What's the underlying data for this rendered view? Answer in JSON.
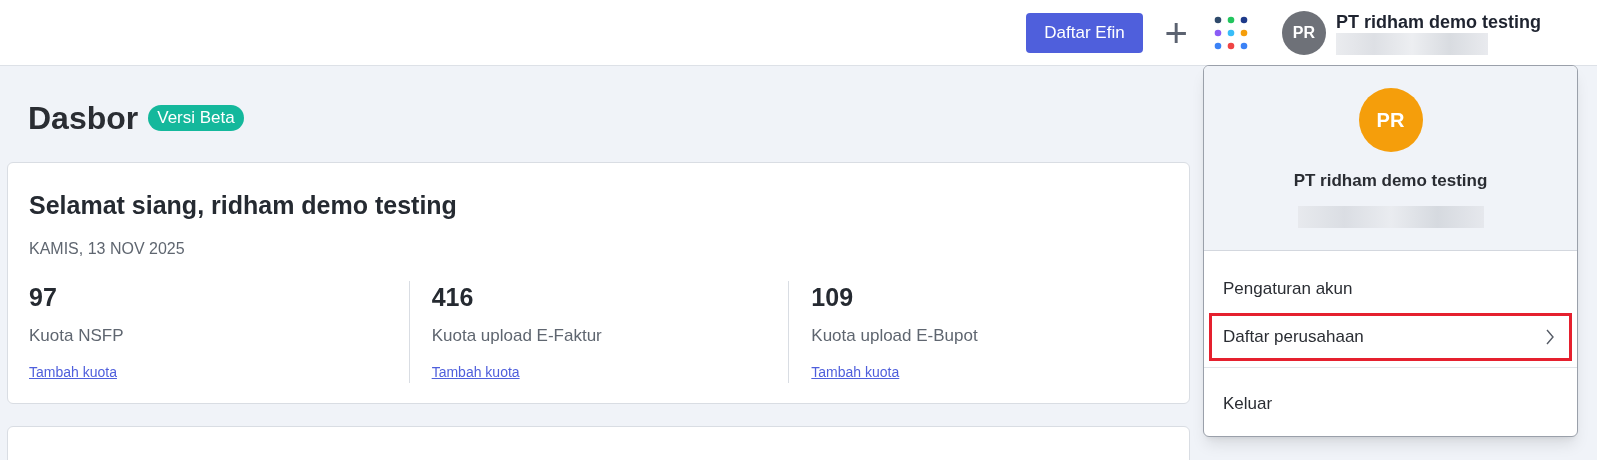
{
  "topbar": {
    "primary_button": "Daftar Efin",
    "plus_icon": "+",
    "account": {
      "initials": "PR",
      "name": "PT ridham demo testing"
    }
  },
  "page": {
    "title": "Dasbor",
    "badge": "Versi Beta"
  },
  "greeting_card": {
    "title": "Selamat siang, ridham demo testing",
    "date": "KAMIS, 13 NOV 2025",
    "stats": [
      {
        "value": "97",
        "label": "Kuota NSFP",
        "link": "Tambah kuota"
      },
      {
        "value": "416",
        "label": "Kuota upload E-Faktur",
        "link": "Tambah kuota"
      },
      {
        "value": "109",
        "label": "Kuota upload E-Bupot",
        "link": "Tambah kuota"
      }
    ]
  },
  "account_menu": {
    "initials": "PR",
    "name": "PT ridham demo testing",
    "items": [
      {
        "label": "Pengaturan akun",
        "has_submenu": false,
        "highlighted": false,
        "divider_before": false
      },
      {
        "label": "Daftar perusahaan",
        "has_submenu": true,
        "highlighted": true,
        "divider_before": false
      },
      {
        "label": "Keluar",
        "has_submenu": false,
        "highlighted": false,
        "divider_before": true
      }
    ]
  }
}
